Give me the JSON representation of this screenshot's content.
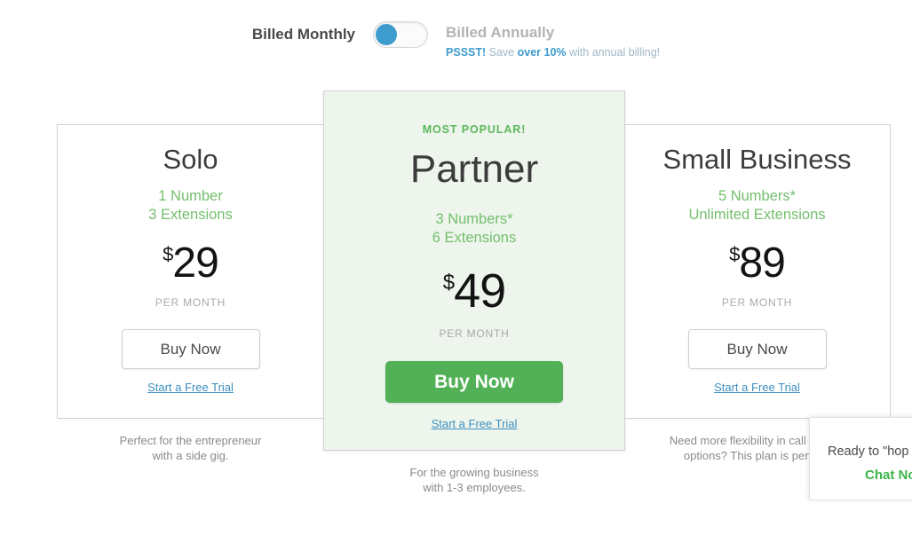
{
  "billing": {
    "monthly_label": "Billed Monthly",
    "annually_label": "Billed Annually",
    "toggle_state": "monthly",
    "promo_prefix": "PSSST!",
    "promo_mid": " Save ",
    "promo_strong": "over 10%",
    "promo_suffix": " with annual billing!",
    "active_color": "#4a4a4a",
    "inactive_color": "#b3b3b3",
    "accent_color": "#3d9bcd"
  },
  "plans": [
    {
      "id": "solo",
      "name": "Solo",
      "feature_1": "1 Number",
      "feature_2": "3 Extensions",
      "currency": "$",
      "price": "29",
      "period": "PER MONTH",
      "buy_label": "Buy Now",
      "trial_label": "Start a Free Trial",
      "caption_line_1": "Perfect for the entrepreneur",
      "caption_line_2": "with a side gig."
    },
    {
      "id": "partner",
      "badge": "MOST POPULAR!",
      "name": "Partner",
      "feature_1": "3 Numbers*",
      "feature_2": "6 Extensions",
      "currency": "$",
      "price": "49",
      "period": "PER MONTH",
      "buy_label": "Buy Now",
      "trial_label": "Start a Free Trial",
      "caption_line_1": "For the growing business",
      "caption_line_2": "with 1-3 employees.",
      "accent_color": "#52b156",
      "background_color": "#edf5ec"
    },
    {
      "id": "small-business",
      "name": "Small Business",
      "feature_1": "5 Numbers*",
      "feature_2": "Unlimited Extensions",
      "currency": "$",
      "price": "89",
      "period": "PER MONTH",
      "buy_label": "Buy Now",
      "trial_label": "Start a Free Trial",
      "caption_line_1": "Need more flexibility in call routing",
      "caption_line_2": "options? This plan is perfect."
    }
  ],
  "chat_widget": {
    "message": "Ready to \"hop",
    "link_label": "Chat No",
    "link_color": "#3bb54a"
  }
}
